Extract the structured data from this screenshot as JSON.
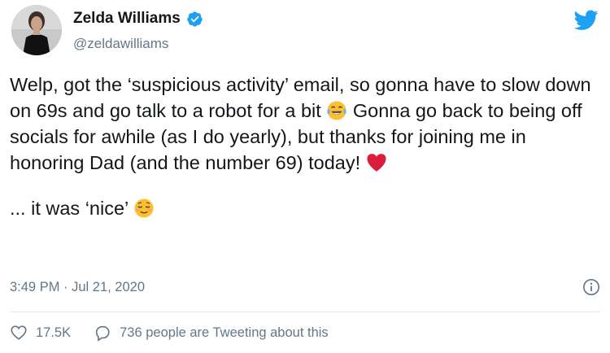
{
  "tweet": {
    "display_name": "Zelda Williams",
    "handle": "@zeldawilliams",
    "verified": true,
    "text_segments": {
      "p1_part1": "Welp, got the ‘suspicious activity’ email, so gonna have to slow down on 69s and go talk to a robot for a bit ",
      "p1_emoji1": "face-with-tears-of-joy",
      "p1_part2": " Gonna go back to being off socials for awhile (as I do yearly), but thanks for joining me in honoring Dad (and the number 69) today! ",
      "p1_emoji2": "red-heart",
      "p2_part1": "... it was ‘nice’ ",
      "p2_emoji1": "relieved-face"
    },
    "timestamp": "3:49 PM · Jul 21, 2020"
  },
  "footer": {
    "likes": "17.5K",
    "conversation": "736 people are Tweeting about this"
  },
  "colors": {
    "twitter_blue": "#1da1f2",
    "text": "#14171a",
    "secondary": "#657786",
    "heart_red": "#d81e3b",
    "emoji_yellow": "#fbc02d"
  },
  "icons": {
    "brand": "twitter-bird-icon",
    "verified": "verified-badge-icon",
    "info": "info-icon",
    "like": "heart-outline-icon",
    "conversation": "speech-bubble-icon"
  }
}
